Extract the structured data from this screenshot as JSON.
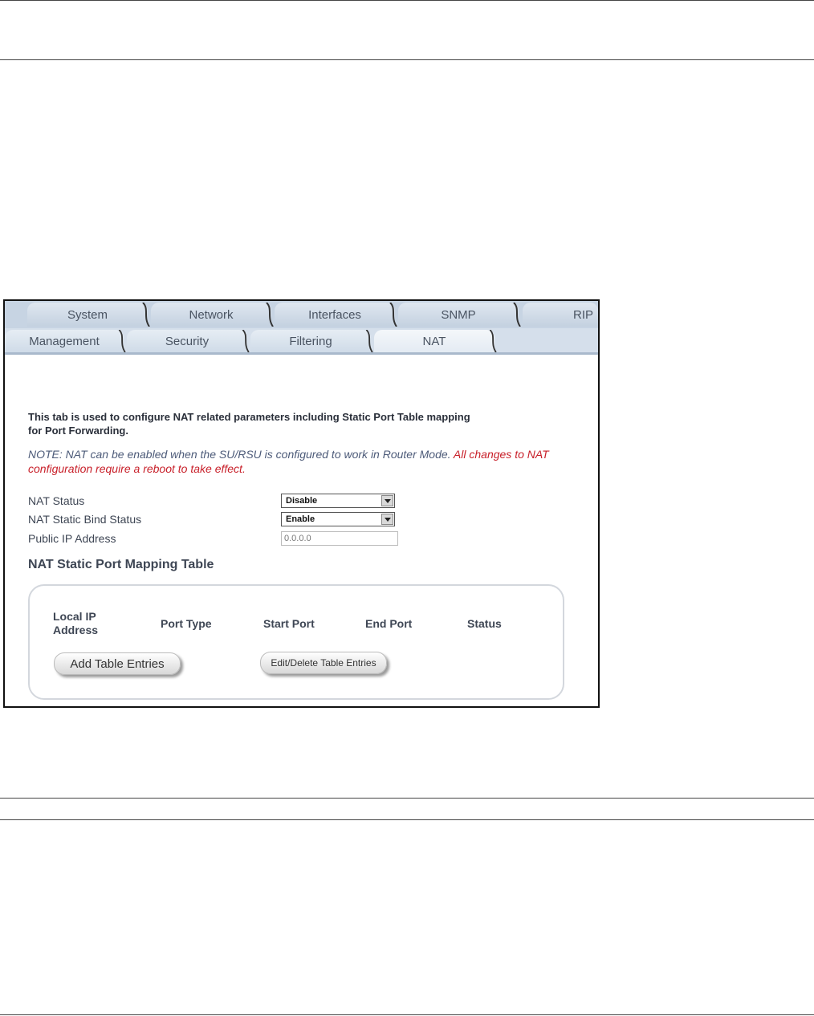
{
  "tabs": {
    "row1": [
      "System",
      "Network",
      "Interfaces",
      "SNMP",
      "RIP"
    ],
    "row2": [
      "Management",
      "Security",
      "Filtering",
      "NAT"
    ],
    "active": "NAT"
  },
  "intro": "This tab is used to configure NAT related parameters including Static Port Table mapping for Port Forwarding.",
  "note": {
    "part1": "NOTE: NAT can be enabled when the SU/RSU is configured to work in Router Mode. ",
    "part2": "All changes to NAT configuration require a reboot to take effect."
  },
  "form": {
    "nat_status_label": "NAT Status",
    "nat_status_value": "Disable",
    "bind_status_label": "NAT Static Bind Status",
    "bind_status_value": "Enable",
    "public_ip_label": "Public IP Address",
    "public_ip_value": "0.0.0.0"
  },
  "table": {
    "title": "NAT Static Port Mapping Table",
    "columns": [
      "Local IP Address",
      "Port Type",
      "Start Port",
      "End Port",
      "Status"
    ],
    "add_button": "Add Table Entries",
    "edit_button": "Edit/Delete Table Entries"
  },
  "colors": {
    "note_text": "#4d5b79",
    "warning_text": "#c8202a",
    "tab_bar": "#c7d4e3"
  }
}
